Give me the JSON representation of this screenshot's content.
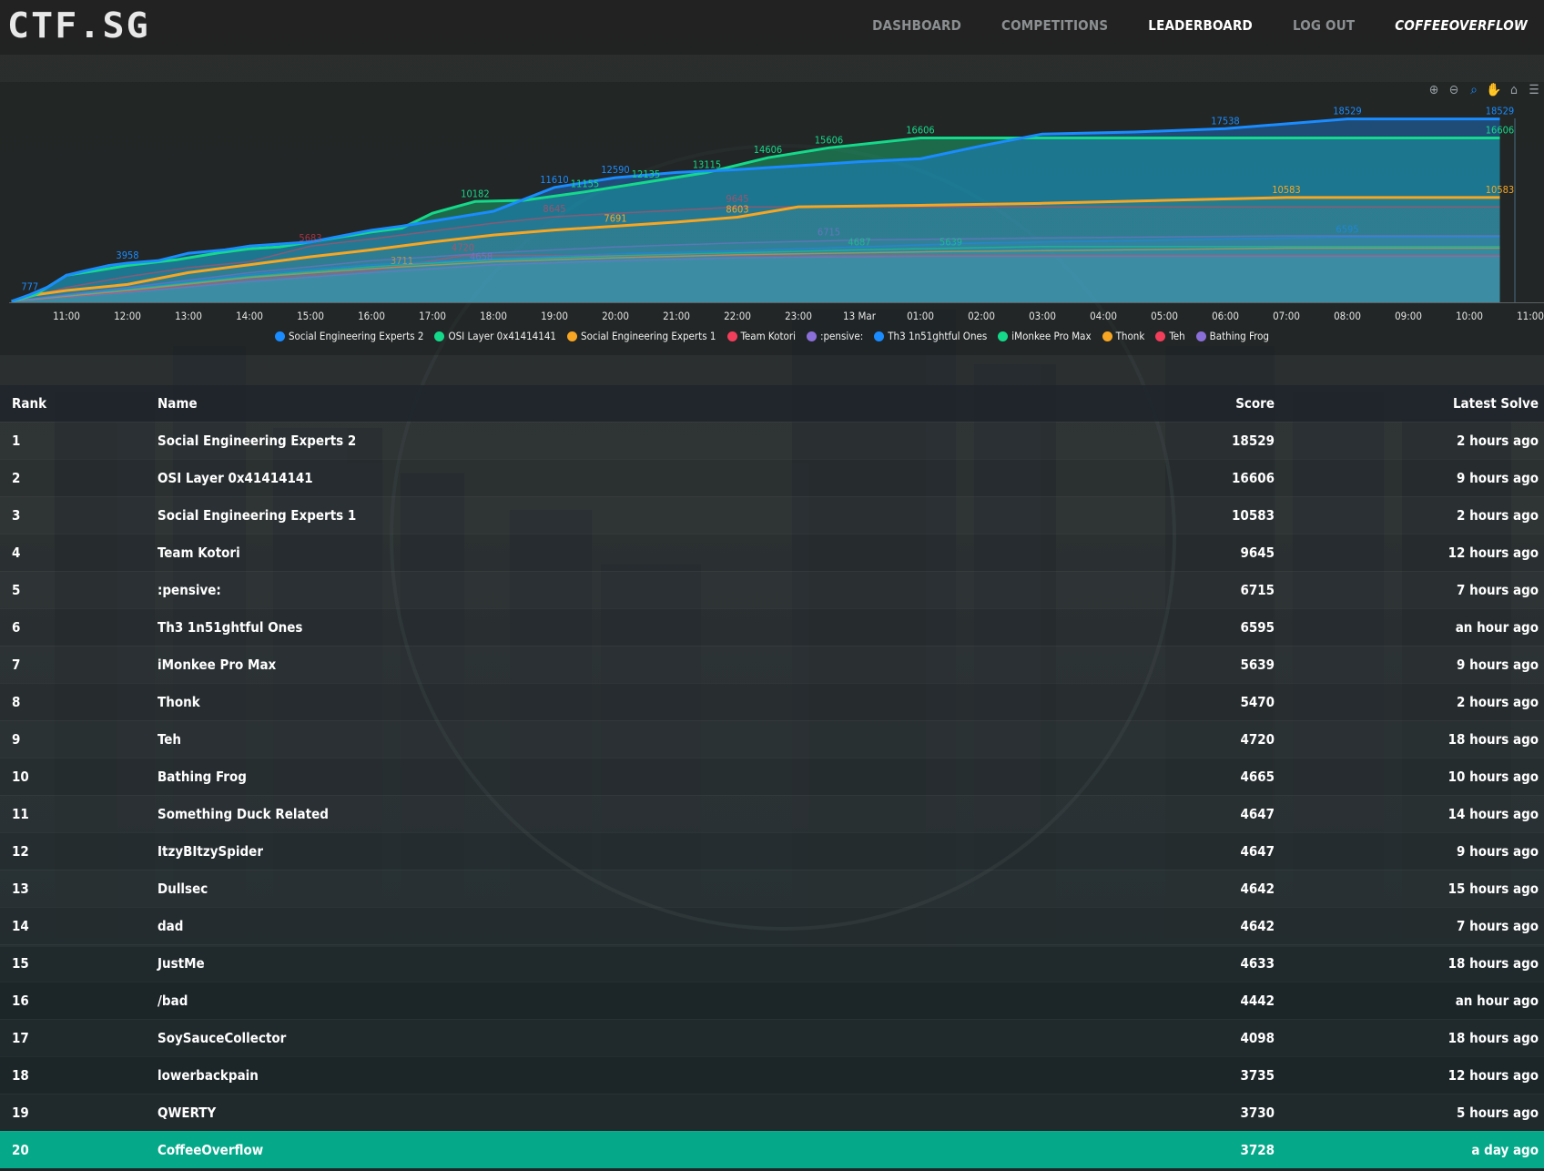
{
  "brand": "CTF.SG",
  "nav": {
    "items": [
      {
        "label": "DASHBOARD"
      },
      {
        "label": "COMPETITIONS"
      },
      {
        "label": "LEADERBOARD"
      },
      {
        "label": "LOG OUT"
      },
      {
        "label": "COFFEEOVERFLOW"
      }
    ]
  },
  "chart_toolbar": [
    "zoom-in-icon",
    "zoom-out-icon",
    "selection-zoom-icon",
    "pan-icon",
    "reset-home-icon",
    "menu-icon"
  ],
  "chart_data": {
    "type": "area",
    "x_ticks": [
      "11:00",
      "12:00",
      "13:00",
      "14:00",
      "15:00",
      "16:00",
      "17:00",
      "18:00",
      "19:00",
      "20:00",
      "21:00",
      "22:00",
      "23:00",
      "13 Mar",
      "01:00",
      "02:00",
      "03:00",
      "04:00",
      "05:00",
      "06:00",
      "07:00",
      "08:00",
      "09:00",
      "10:00",
      "11:00"
    ],
    "series": [
      {
        "name": "Social Engineering Experts 2",
        "color": "#1a8cff",
        "points": [
          [
            -0.9,
            100
          ],
          [
            -0.6,
            777
          ],
          [
            -0.3,
            1565
          ],
          [
            0,
            2734
          ],
          [
            0.3,
            3173
          ],
          [
            0.7,
            3723
          ],
          [
            1,
            3958
          ],
          [
            1.5,
            4200
          ],
          [
            2,
            4958
          ],
          [
            2.6,
            5300
          ],
          [
            3,
            5684
          ],
          [
            4,
            6100
          ],
          [
            5,
            7281
          ],
          [
            5.5,
            7700
          ],
          [
            6,
            8192
          ],
          [
            7,
            9200
          ],
          [
            8,
            11610
          ],
          [
            9,
            12590
          ],
          [
            10,
            13115
          ],
          [
            11,
            13400
          ],
          [
            12,
            13800
          ],
          [
            13,
            14200
          ],
          [
            14,
            14500
          ],
          [
            15,
            15800
          ],
          [
            16,
            17000
          ],
          [
            17.5,
            17200
          ],
          [
            19,
            17538
          ],
          [
            21,
            18529
          ],
          [
            23.5,
            18529
          ]
        ],
        "labels": [
          [
            -0.6,
            "777"
          ],
          [
            1,
            "3958"
          ],
          [
            8,
            "11610"
          ],
          [
            9,
            "12590"
          ],
          [
            19,
            "17538"
          ],
          [
            21,
            "18529"
          ],
          [
            23.5,
            "18529"
          ]
        ]
      },
      {
        "name": "OSI Layer 0x41414141",
        "color": "#14d98a",
        "points": [
          [
            -0.9,
            100
          ],
          [
            -0.5,
            800
          ],
          [
            0,
            2734
          ],
          [
            0.5,
            3200
          ],
          [
            1,
            3723
          ],
          [
            1.8,
            4300
          ],
          [
            2.5,
            5000
          ],
          [
            3,
            5400
          ],
          [
            3.5,
            5600
          ],
          [
            4,
            6100
          ],
          [
            5,
            7100
          ],
          [
            5.5,
            7500
          ],
          [
            6,
            9000
          ],
          [
            6.7,
            10182
          ],
          [
            7.5,
            10300
          ],
          [
            8.5,
            11155
          ],
          [
            9.5,
            12135
          ],
          [
            10.5,
            13115
          ],
          [
            11.5,
            14606
          ],
          [
            12.5,
            15606
          ],
          [
            14,
            16606
          ],
          [
            16,
            16606
          ],
          [
            23.5,
            16606
          ]
        ],
        "labels": [
          [
            6.7,
            "10182"
          ],
          [
            8.5,
            "11155"
          ],
          [
            9.5,
            "12135"
          ],
          [
            10.5,
            "13115"
          ],
          [
            11.5,
            "14606"
          ],
          [
            12.5,
            "15606"
          ],
          [
            14,
            "16606"
          ],
          [
            23.5,
            "16606"
          ]
        ]
      },
      {
        "name": "Social Engineering Experts 1",
        "color": "#f6a623",
        "points": [
          [
            -0.9,
            100
          ],
          [
            -0.5,
            777
          ],
          [
            0,
            1200
          ],
          [
            1,
            1800
          ],
          [
            2,
            3000
          ],
          [
            3,
            3800
          ],
          [
            4,
            4600
          ],
          [
            5,
            5300
          ],
          [
            6,
            6100
          ],
          [
            7,
            6800
          ],
          [
            8,
            7300
          ],
          [
            9,
            7691
          ],
          [
            10,
            8100
          ],
          [
            11,
            8603
          ],
          [
            12,
            9645
          ],
          [
            14,
            9800
          ],
          [
            16,
            10000
          ],
          [
            18,
            10300
          ],
          [
            20,
            10583
          ],
          [
            23.5,
            10583
          ]
        ],
        "labels": [
          [
            9,
            "7691"
          ],
          [
            11,
            "8603"
          ],
          [
            20,
            "10583"
          ],
          [
            23.5,
            "10583"
          ]
        ]
      },
      {
        "name": "Team Kotori",
        "color": "#f23e5a",
        "points": [
          [
            -0.9,
            100
          ],
          [
            0,
            1500
          ],
          [
            1,
            2600
          ],
          [
            2,
            3500
          ],
          [
            3,
            4100
          ],
          [
            4,
            5683
          ],
          [
            5,
            6400
          ],
          [
            6,
            7200
          ],
          [
            7,
            8000
          ],
          [
            8,
            8645
          ],
          [
            9,
            9000
          ],
          [
            10,
            9300
          ],
          [
            11,
            9645
          ],
          [
            12,
            9645
          ],
          [
            23.5,
            9645
          ]
        ],
        "labels": [
          [
            4,
            "5683"
          ],
          [
            8,
            "8645"
          ],
          [
            11,
            "9645"
          ]
        ]
      },
      {
        "name": ":pensive:",
        "color": "#8a6fd8",
        "points": [
          [
            -0.9,
            100
          ],
          [
            1,
            1500
          ],
          [
            3,
            3000
          ],
          [
            5,
            4200
          ],
          [
            7,
            5000
          ],
          [
            9,
            5600
          ],
          [
            11,
            6000
          ],
          [
            13,
            6300
          ],
          [
            16,
            6500
          ],
          [
            20,
            6715
          ],
          [
            23.5,
            6715
          ]
        ],
        "labels": [
          [
            12.5,
            "6715"
          ]
        ]
      },
      {
        "name": "Th3 1n51ghtful Ones",
        "color": "#1a8cff",
        "points": [
          [
            -0.9,
            100
          ],
          [
            1,
            1400
          ],
          [
            3,
            2800
          ],
          [
            5,
            3800
          ],
          [
            7,
            4400
          ],
          [
            9,
            4900
          ],
          [
            11,
            5200
          ],
          [
            13,
            5600
          ],
          [
            15,
            6000
          ],
          [
            18,
            6300
          ],
          [
            21,
            6595
          ],
          [
            23.5,
            6595
          ]
        ],
        "labels": [
          [
            21,
            "6595"
          ]
        ]
      },
      {
        "name": "iMonkee Pro Max",
        "color": "#14d98a",
        "points": [
          [
            -0.9,
            100
          ],
          [
            1,
            1300
          ],
          [
            3,
            2600
          ],
          [
            5,
            3600
          ],
          [
            7,
            4300
          ],
          [
            9,
            4700
          ],
          [
            11,
            5000
          ],
          [
            13,
            5300
          ],
          [
            16,
            5639
          ],
          [
            23.5,
            5639
          ]
        ],
        "labels": [
          [
            13,
            "4687"
          ],
          [
            14.5,
            "5639"
          ]
        ]
      },
      {
        "name": "Thonk",
        "color": "#f6a623",
        "points": [
          [
            -0.9,
            100
          ],
          [
            1,
            1200
          ],
          [
            3,
            2500
          ],
          [
            5,
            3400
          ],
          [
            7,
            4100
          ],
          [
            9,
            4500
          ],
          [
            11,
            4800
          ],
          [
            14,
            5100
          ],
          [
            20,
            5470
          ],
          [
            23.5,
            5470
          ]
        ],
        "labels": [
          [
            5.5,
            "3711"
          ]
        ]
      },
      {
        "name": "Teh",
        "color": "#f23e5a",
        "points": [
          [
            -0.9,
            100
          ],
          [
            1,
            1100
          ],
          [
            3,
            2300
          ],
          [
            5,
            3200
          ],
          [
            6.5,
            4720
          ],
          [
            8,
            4720
          ],
          [
            23.5,
            4720
          ]
        ],
        "labels": [
          [
            6.5,
            "4720"
          ]
        ]
      },
      {
        "name": "Bathing Frog",
        "color": "#8a6fd8",
        "points": [
          [
            -0.9,
            100
          ],
          [
            1,
            1000
          ],
          [
            3,
            2100
          ],
          [
            5,
            3000
          ],
          [
            7,
            3800
          ],
          [
            9,
            4200
          ],
          [
            11,
            4500
          ],
          [
            14,
            4665
          ],
          [
            23.5,
            4665
          ]
        ],
        "labels": [
          [
            6.8,
            "4658"
          ]
        ]
      }
    ],
    "ylim": [
      0,
      19500
    ],
    "grid": false,
    "legend": "bottom"
  },
  "table": {
    "headers": {
      "rank": "Rank",
      "name": "Name",
      "score": "Score",
      "solve": "Latest Solve"
    },
    "rows": [
      {
        "rank": "1",
        "name": "Social Engineering Experts 2",
        "score": "18529",
        "solve": "2 hours ago"
      },
      {
        "rank": "2",
        "name": "OSI Layer 0x41414141",
        "score": "16606",
        "solve": "9 hours ago"
      },
      {
        "rank": "3",
        "name": "Social Engineering Experts 1",
        "score": "10583",
        "solve": "2 hours ago"
      },
      {
        "rank": "4",
        "name": "Team Kotori",
        "score": "9645",
        "solve": "12 hours ago"
      },
      {
        "rank": "5",
        "name": ":pensive:",
        "score": "6715",
        "solve": "7 hours ago"
      },
      {
        "rank": "6",
        "name": "Th3 1n51ghtful Ones",
        "score": "6595",
        "solve": "an hour ago"
      },
      {
        "rank": "7",
        "name": "iMonkee Pro Max",
        "score": "5639",
        "solve": "9 hours ago"
      },
      {
        "rank": "8",
        "name": "Thonk",
        "score": "5470",
        "solve": "2 hours ago"
      },
      {
        "rank": "9",
        "name": "Teh",
        "score": "4720",
        "solve": "18 hours ago"
      },
      {
        "rank": "10",
        "name": "Bathing Frog",
        "score": "4665",
        "solve": "10 hours ago"
      },
      {
        "rank": "11",
        "name": "Something Duck Related",
        "score": "4647",
        "solve": "14 hours ago"
      },
      {
        "rank": "12",
        "name": "ItzyBItzySpider",
        "score": "4647",
        "solve": "9 hours ago"
      },
      {
        "rank": "13",
        "name": "Dullsec",
        "score": "4642",
        "solve": "15 hours ago"
      },
      {
        "rank": "14",
        "name": "dad",
        "score": "4642",
        "solve": "7 hours ago"
      },
      {
        "rank": "15",
        "name": "JustMe",
        "score": "4633",
        "solve": "18 hours ago"
      },
      {
        "rank": "16",
        "name": "/bad",
        "score": "4442",
        "solve": "an hour ago"
      },
      {
        "rank": "17",
        "name": "SoySauceCollector",
        "score": "4098",
        "solve": "18 hours ago"
      },
      {
        "rank": "18",
        "name": "lowerbackpain",
        "score": "3735",
        "solve": "12 hours ago"
      },
      {
        "rank": "19",
        "name": "QWERTY",
        "score": "3730",
        "solve": "5 hours ago"
      },
      {
        "rank": "20",
        "name": "CoffeeOverflow",
        "score": "3728",
        "solve": "a day ago",
        "highlight": true
      }
    ]
  },
  "colors": {
    "highlight": "#05a98a",
    "accent_blue": "#1a8cff",
    "accent_green": "#14d98a"
  }
}
